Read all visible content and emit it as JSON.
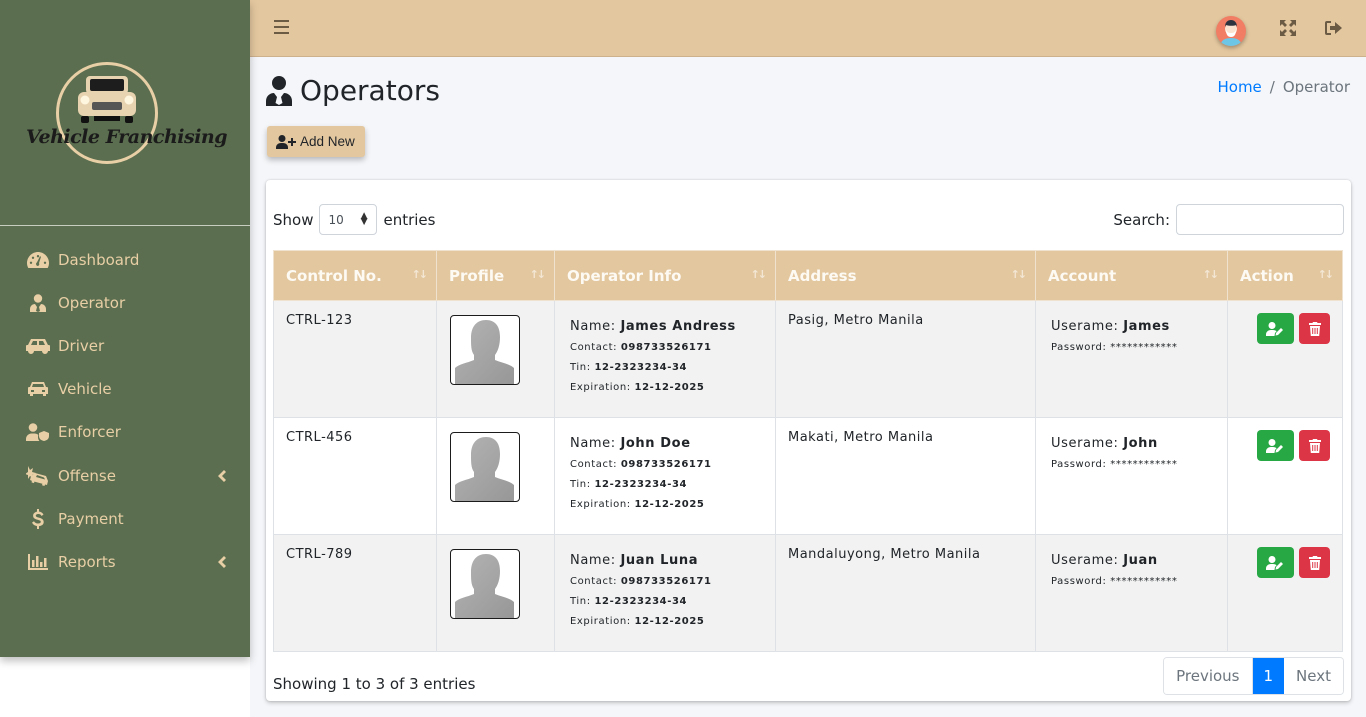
{
  "brand": {
    "name": "Vehicle Franchising"
  },
  "sidebar": {
    "items": [
      {
        "label": "Dashboard",
        "icon": "tachometer-icon",
        "has_submenu": false
      },
      {
        "label": "Operator",
        "icon": "user-tie-icon",
        "has_submenu": false
      },
      {
        "label": "Driver",
        "icon": "car-icon",
        "has_submenu": false
      },
      {
        "label": "Vehicle",
        "icon": "car-front-icon",
        "has_submenu": false
      },
      {
        "label": "Enforcer",
        "icon": "user-shield-icon",
        "has_submenu": false
      },
      {
        "label": "Offense",
        "icon": "car-crash-icon",
        "has_submenu": true
      },
      {
        "label": "Payment",
        "icon": "dollar-icon",
        "has_submenu": false
      },
      {
        "label": "Reports",
        "icon": "chart-bar-icon",
        "has_submenu": true
      }
    ]
  },
  "topbar": {
    "menu_icon": "hamburger-icon",
    "avatar_icon": "user-avatar-icon",
    "fullscreen_icon": "expand-icon",
    "logout_icon": "sign-out-icon"
  },
  "page": {
    "title": "Operators",
    "breadcrumb": {
      "home": "Home",
      "separator": "/",
      "current": "Operator"
    },
    "add_button": "Add New"
  },
  "table_controls": {
    "show_label": "Show",
    "entries_label": "entries",
    "page_length": "10",
    "search_label": "Search:",
    "search_value": ""
  },
  "table": {
    "columns": [
      "Control No.",
      "Profile",
      "Operator Info",
      "Address",
      "Account",
      "Action"
    ],
    "labels": {
      "name": "Name:",
      "contact": "Contact:",
      "tin": "Tin:",
      "expiration": "Expiration:",
      "username": "Userame:",
      "password": "Password:"
    },
    "rows": [
      {
        "control_no": "CTRL-123",
        "name": "James Andress",
        "contact": "098733526171",
        "tin": "12-2323234-34",
        "expiration": "12-12-2025",
        "address": "Pasig, Metro Manila",
        "username": "James",
        "password": "************"
      },
      {
        "control_no": "CTRL-456",
        "name": "John Doe",
        "contact": "098733526171",
        "tin": "12-2323234-34",
        "expiration": "12-12-2025",
        "address": "Makati, Metro Manila",
        "username": "John",
        "password": "************"
      },
      {
        "control_no": "CTRL-789",
        "name": "Juan Luna",
        "contact": "098733526171",
        "tin": "12-2323234-34",
        "expiration": "12-12-2025",
        "address": "Mandaluyong, Metro Manila",
        "username": "Juan",
        "password": "************"
      }
    ]
  },
  "footer": {
    "info": "Showing 1 to 3 of 3 entries",
    "pagination": {
      "previous": "Previous",
      "current": "1",
      "next": "Next"
    }
  },
  "colors": {
    "sidebar_bg": "#5b6e4f",
    "accent_tan": "#e3c79f",
    "edit_green": "#28a745",
    "delete_red": "#dc3545",
    "link_blue": "#007bff"
  }
}
